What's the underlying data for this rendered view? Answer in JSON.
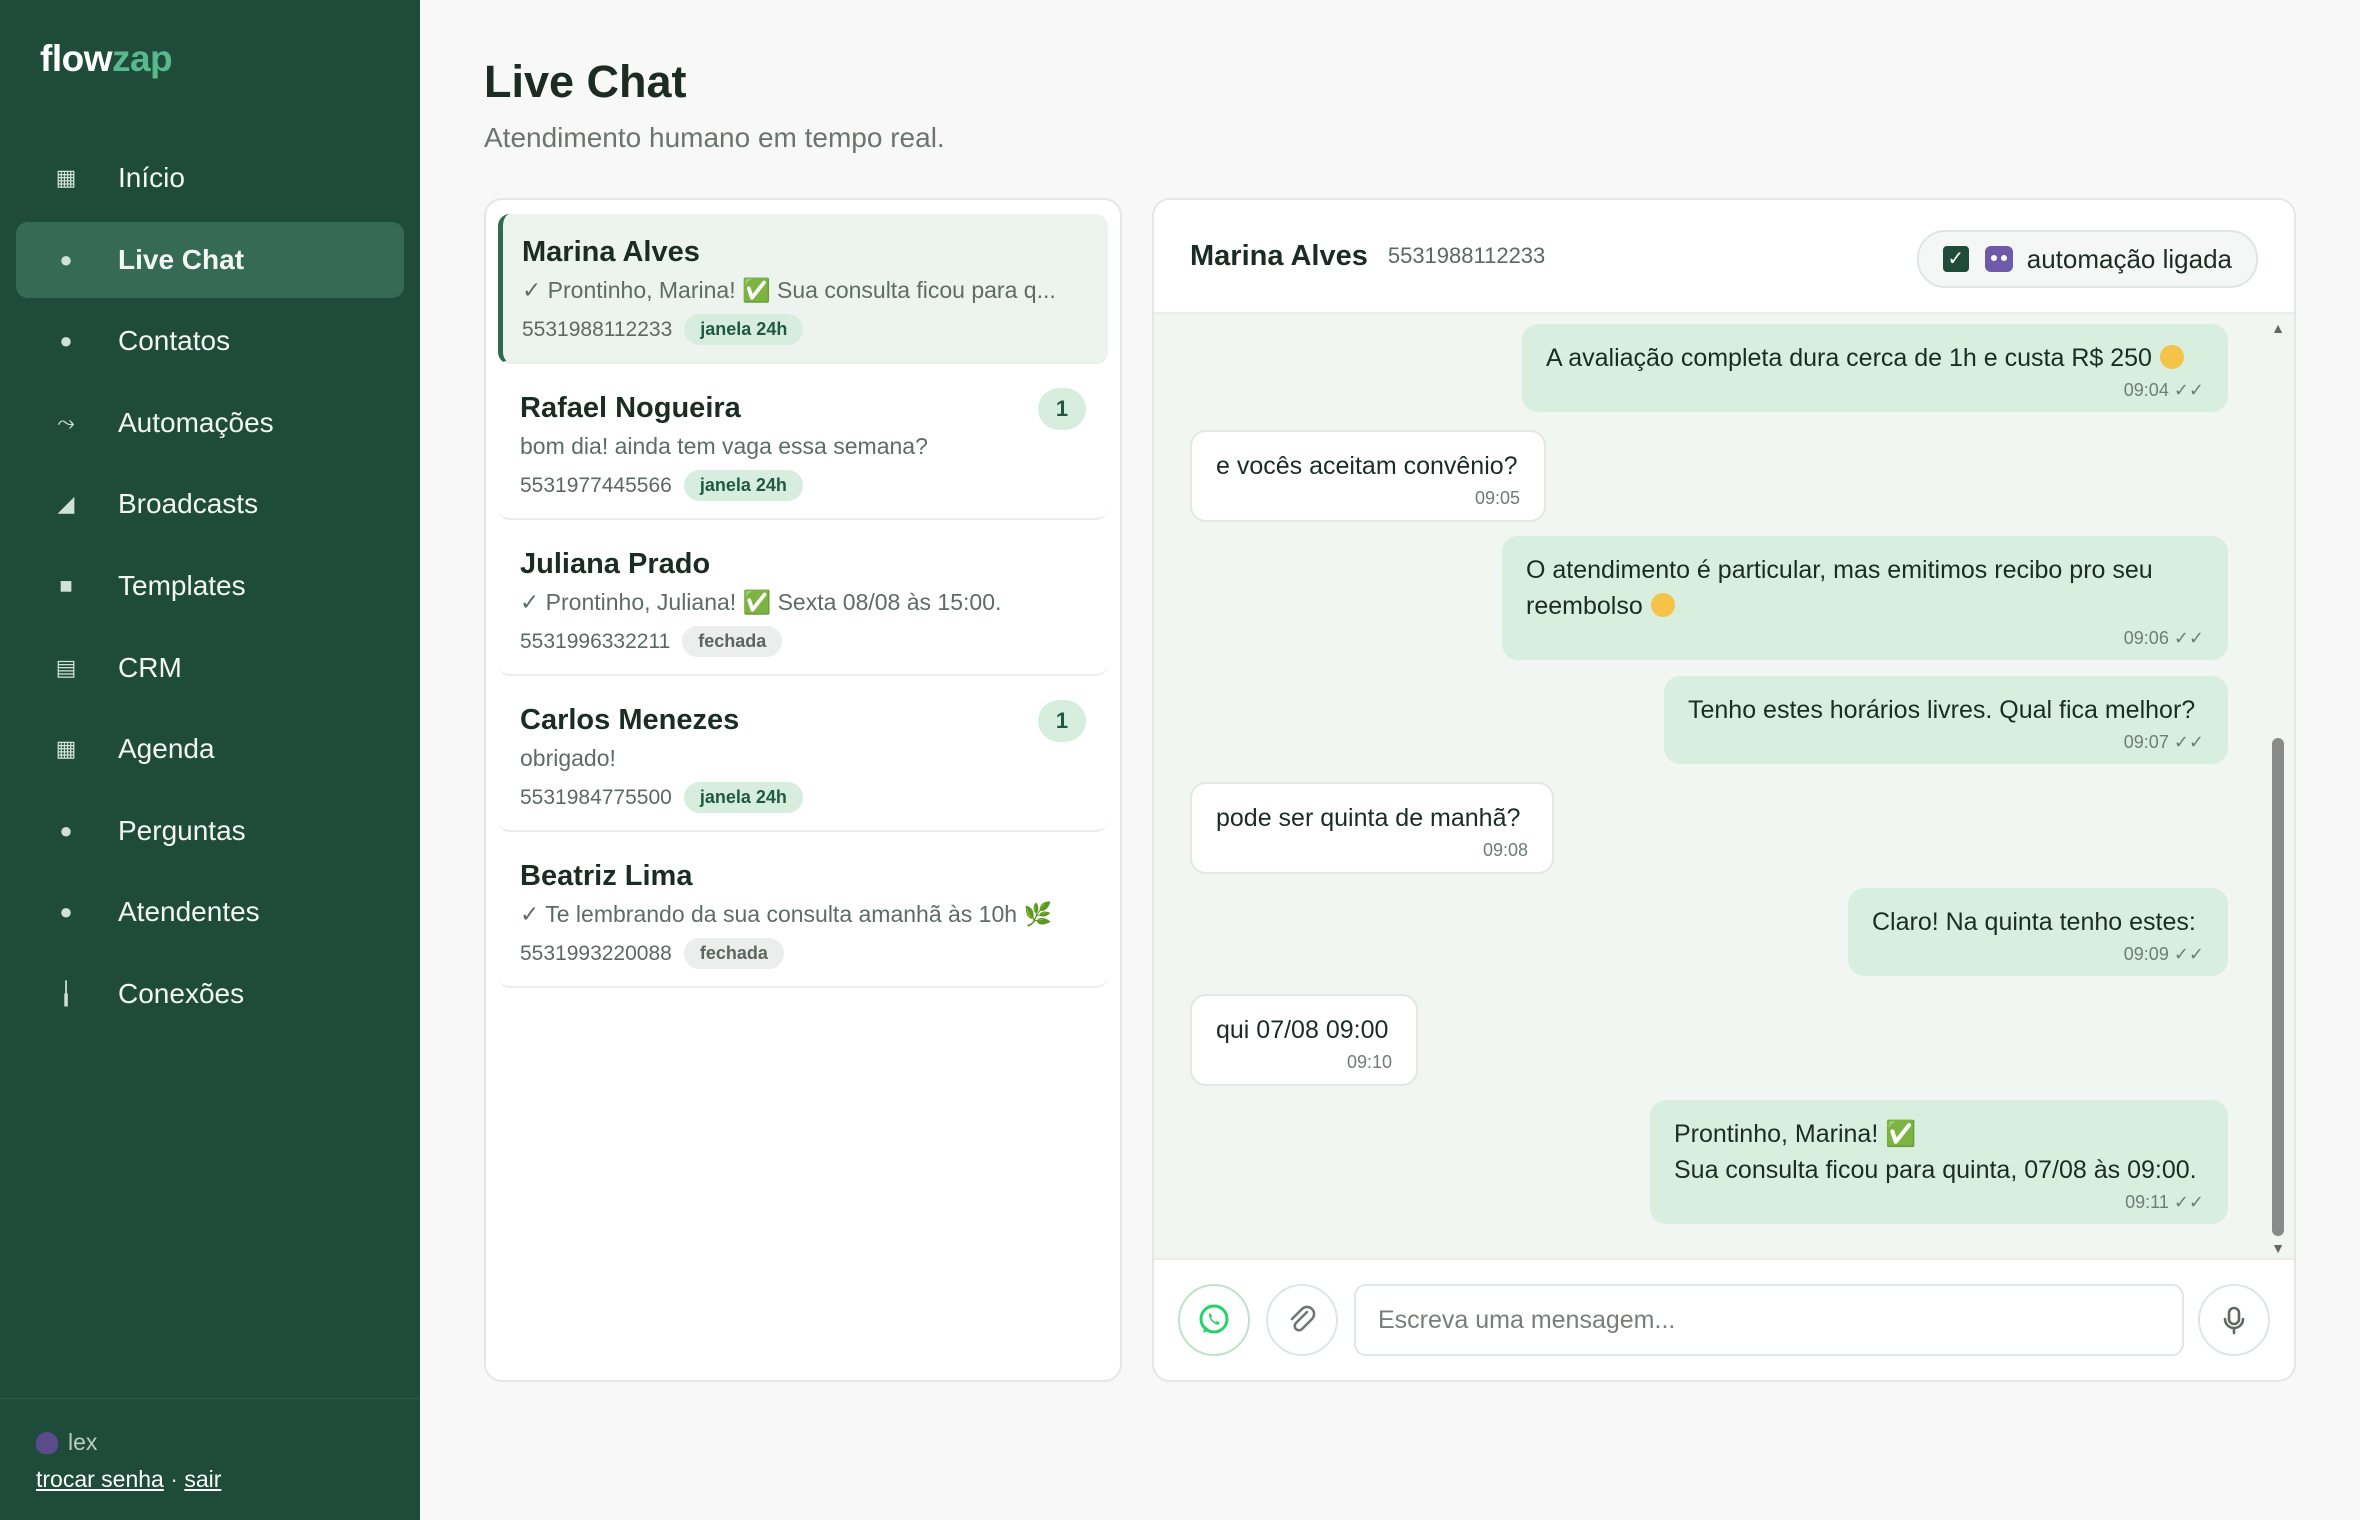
{
  "brand": {
    "part1": "flow",
    "part2": "zap"
  },
  "nav": [
    {
      "label": "Início",
      "icon": "grid-icon",
      "glyph": "▦"
    },
    {
      "label": "Live Chat",
      "icon": "chat-bubble-icon",
      "glyph": "●",
      "active": true
    },
    {
      "label": "Contatos",
      "icon": "person-icon",
      "glyph": "●"
    },
    {
      "label": "Automações",
      "icon": "arrow-icon",
      "glyph": "⤳"
    },
    {
      "label": "Broadcasts",
      "icon": "megaphone-icon",
      "glyph": "◢"
    },
    {
      "label": "Templates",
      "icon": "folder-icon",
      "glyph": "■"
    },
    {
      "label": "CRM",
      "icon": "list-icon",
      "glyph": "▤"
    },
    {
      "label": "Agenda",
      "icon": "calendar-icon",
      "glyph": "▦"
    },
    {
      "label": "Perguntas",
      "icon": "lightbulb-icon",
      "glyph": "●"
    },
    {
      "label": "Atendentes",
      "icon": "agent-icon",
      "glyph": "●"
    },
    {
      "label": "Conexões",
      "icon": "plug-icon",
      "glyph": "╽"
    }
  ],
  "user": {
    "name": "lex",
    "change_password": "trocar senha",
    "separator": " · ",
    "logout": "sair"
  },
  "header": {
    "title": "Live Chat",
    "subtitle": "Atendimento humano em tempo real."
  },
  "conversations": [
    {
      "name": "Marina Alves",
      "preview": "✓ Prontinho, Marina! ✅ Sua consulta ficou para q...",
      "phone": "5531988112233",
      "status": "janela 24h",
      "active": true
    },
    {
      "name": "Rafael Nogueira",
      "preview": "bom dia! ainda tem vaga essa semana?",
      "phone": "5531977445566",
      "status": "janela 24h",
      "unread": "1"
    },
    {
      "name": "Juliana Prado",
      "preview": "✓ Prontinho, Juliana! ✅ Sexta 08/08 às 15:00.",
      "phone": "5531996332211",
      "status": "fechada"
    },
    {
      "name": "Carlos Menezes",
      "preview": "obrigado!",
      "phone": "5531984775500",
      "status": "janela 24h",
      "unread": "1"
    },
    {
      "name": "Beatriz Lima",
      "preview": "✓ Te lembrando da sua consulta amanhã às 10h 🌿",
      "phone": "5531993220088",
      "status": "fechada"
    }
  ],
  "chat": {
    "contact_name": "Marina Alves",
    "contact_phone": "5531988112233",
    "automation_label": "automação ligada",
    "composer_placeholder": "Escreva uma mensagem...",
    "messages": [
      {
        "dir": "out",
        "text": "A avaliação completa dura cerca de 1h e custa R$ 250",
        "emoji": "smile",
        "time": "09:04 ✓✓"
      },
      {
        "dir": "in",
        "text": "e vocês aceitam convênio?",
        "time": "09:05"
      },
      {
        "dir": "out",
        "text": "O atendimento é particular, mas emitimos recibo pro seu reembolso",
        "emoji": "smile",
        "time": "09:06 ✓✓"
      },
      {
        "dir": "out",
        "text": "Tenho estes horários livres. Qual fica melhor?",
        "time": "09:07 ✓✓"
      },
      {
        "dir": "in",
        "text": "pode ser quinta de manhã?",
        "time": "09:08"
      },
      {
        "dir": "out",
        "text": "Claro! Na quinta tenho estes:",
        "time": "09:09 ✓✓"
      },
      {
        "dir": "in",
        "text": "qui 07/08 09:00",
        "time": "09:10"
      },
      {
        "dir": "out",
        "text": "Prontinho, Marina! ✅\nSua consulta ficou para quinta, 07/08 às 09:00.",
        "time": "09:11 ✓✓"
      }
    ]
  },
  "colors": {
    "sidebar": "#1e4b3a",
    "active_nav": "#356a55",
    "brand_accent": "#58b98c",
    "outgoing_bubble": "#d8efe0",
    "whatsapp_green": "#25d366"
  }
}
